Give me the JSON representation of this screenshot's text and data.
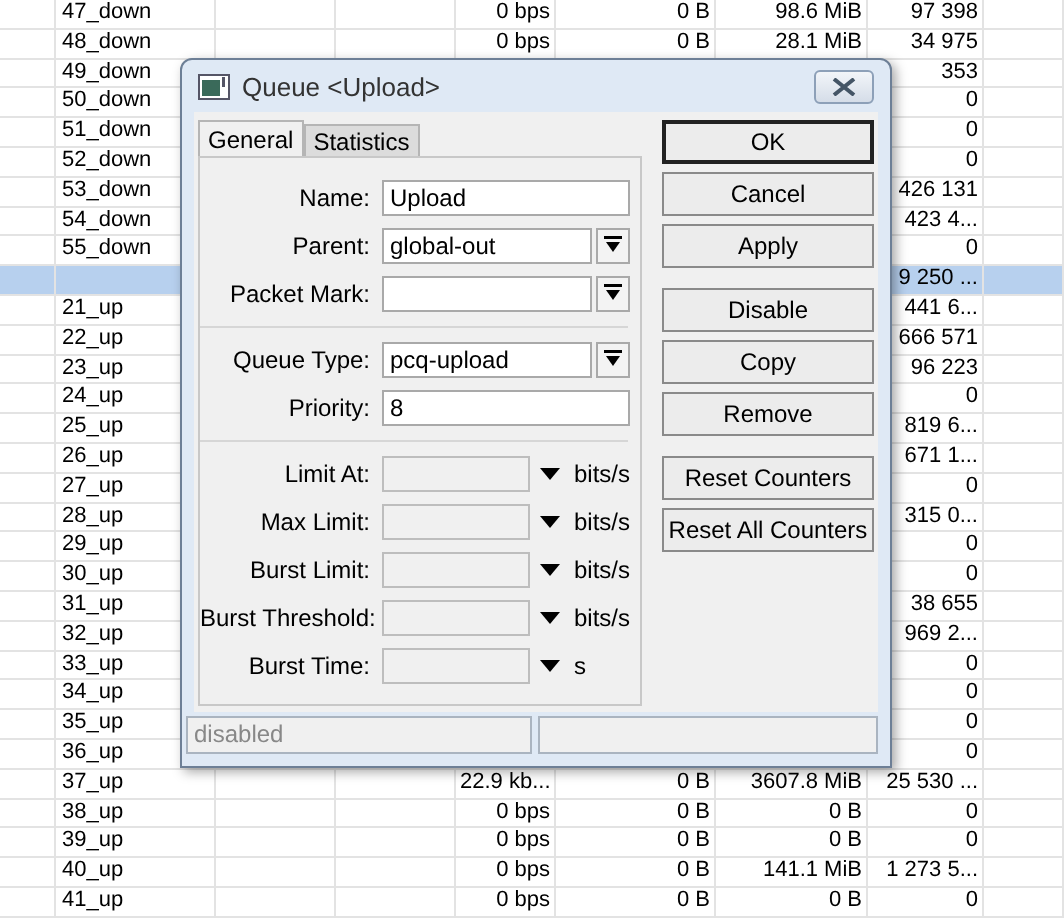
{
  "table": {
    "rows": [
      {
        "column_2": "47_down",
        "column_5": "0 bps",
        "column_6": "0 B",
        "column_7": "98.6 MiB",
        "column_8": "97 398",
        "selected": false
      },
      {
        "column_2": "48_down",
        "column_5": "0 bps",
        "column_6": "0 B",
        "column_7": "28.1 MiB",
        "column_8": "34 975",
        "selected": false
      },
      {
        "column_2": "49_down",
        "column_8": "353",
        "selected": false
      },
      {
        "column_2": "50_down",
        "column_8": "0",
        "selected": false
      },
      {
        "column_2": "51_down",
        "column_8": "0",
        "selected": false
      },
      {
        "column_2": "52_down",
        "column_8": "0",
        "selected": false
      },
      {
        "column_2": "53_down",
        "column_8": "426 131",
        "selected": false
      },
      {
        "column_2": "54_down",
        "column_8": "423 4...",
        "selected": false
      },
      {
        "column_2": "55_down",
        "column_8": "0",
        "selected": false
      },
      {
        "column_8": "9 250 ...",
        "selected": true
      },
      {
        "column_2": "21_up",
        "column_8": "441 6...",
        "selected": false
      },
      {
        "column_2": "22_up",
        "column_8": "666 571",
        "selected": false
      },
      {
        "column_2": "23_up",
        "column_8": "96 223",
        "selected": false
      },
      {
        "column_2": "24_up",
        "column_8": "0",
        "selected": false
      },
      {
        "column_2": "25_up",
        "column_8": "819 6...",
        "selected": false
      },
      {
        "column_2": "26_up",
        "column_8": "671 1...",
        "selected": false
      },
      {
        "column_2": "27_up",
        "column_8": "0",
        "selected": false
      },
      {
        "column_2": "28_up",
        "column_8": "315 0...",
        "selected": false
      },
      {
        "column_2": "29_up",
        "column_8": "0",
        "selected": false
      },
      {
        "column_2": "30_up",
        "column_8": "0",
        "selected": false
      },
      {
        "column_2": "31_up",
        "column_8": "38 655",
        "selected": false
      },
      {
        "column_2": "32_up",
        "column_8": "969 2...",
        "selected": false
      },
      {
        "column_2": "33_up",
        "column_8": "0",
        "selected": false
      },
      {
        "column_2": "34_up",
        "column_8": "0",
        "selected": false
      },
      {
        "column_2": "35_up",
        "column_8": "0",
        "selected": false
      },
      {
        "column_2": "36_up",
        "column_8": "0",
        "selected": false
      },
      {
        "column_2": "37_up",
        "column_5": "22.9 kb...",
        "column_6": "0 B",
        "column_7": "3607.8 MiB",
        "column_8": "25 530 ...",
        "selected": false
      },
      {
        "column_2": "38_up",
        "column_5": "0 bps",
        "column_6": "0 B",
        "column_7": "0 B",
        "column_8": "0",
        "selected": false
      },
      {
        "column_2": "39_up",
        "column_5": "0 bps",
        "column_6": "0 B",
        "column_7": "0 B",
        "column_8": "0",
        "selected": false
      },
      {
        "column_2": "40_up",
        "column_5": "0 bps",
        "column_6": "0 B",
        "column_7": "141.1 MiB",
        "column_8": "1 273 5...",
        "selected": false
      },
      {
        "column_2": "41_up",
        "column_5": "0 bps",
        "column_6": "0 B",
        "column_7": "0 B",
        "column_8": "0",
        "selected": false
      }
    ]
  },
  "dialog": {
    "title": "Queue <Upload>",
    "tabs": [
      {
        "label": "General",
        "selected": true
      },
      {
        "label": "Statistics",
        "selected": false
      }
    ],
    "field_groups": [
      [
        {
          "kind": "text",
          "label": "Name:",
          "value": "Upload"
        },
        {
          "kind": "dropdown",
          "label": "Parent:",
          "value": "global-out"
        },
        {
          "kind": "dropdown",
          "label": "Packet Mark:"
        }
      ],
      [
        {
          "kind": "dropdown",
          "label": "Queue Type:",
          "value": "pcq-upload"
        },
        {
          "kind": "text",
          "label": "Priority:",
          "value": "8"
        }
      ],
      [
        {
          "kind": "limit",
          "label": "Limit At:",
          "unit": "bits/s"
        },
        {
          "kind": "limit",
          "label": "Max Limit:",
          "unit": "bits/s"
        },
        {
          "kind": "limit",
          "label": "Burst Limit:",
          "unit": "bits/s"
        },
        {
          "kind": "limit",
          "label": "Burst Threshold:",
          "unit": "bits/s"
        },
        {
          "kind": "limit",
          "label": "Burst Time:",
          "unit": "s"
        }
      ]
    ],
    "button_groups": [
      [
        {
          "label": "OK",
          "default": true
        },
        {
          "label": "Cancel",
          "default": false
        },
        {
          "label": "Apply",
          "default": false
        }
      ],
      [
        {
          "label": "Disable",
          "default": false
        },
        {
          "label": "Copy",
          "default": false
        },
        {
          "label": "Remove",
          "default": false
        }
      ],
      [
        {
          "label": "Reset Counters",
          "default": false
        },
        {
          "label": "Reset All Counters",
          "default": false
        }
      ]
    ],
    "status_bar": {
      "text": "disabled"
    }
  }
}
